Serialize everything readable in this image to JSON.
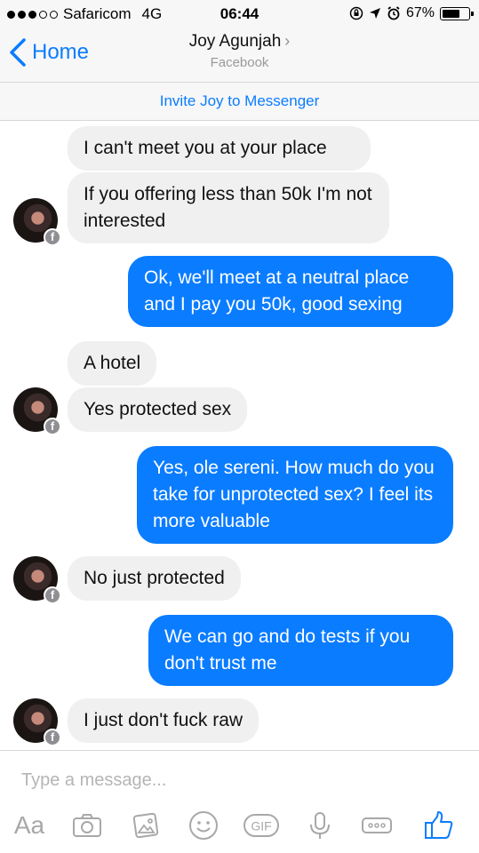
{
  "status_bar": {
    "carrier": "Safaricom",
    "network": "4G",
    "time": "06:44",
    "battery": "67%",
    "battery_level": 0.67
  },
  "nav": {
    "back_label": "Home",
    "contact_name": "Joy Agunjah",
    "chevron": "›",
    "subtitle": "Facebook"
  },
  "invite_banner": "Invite Joy to Messenger",
  "messages": [
    {
      "from": "them",
      "text": "I can't meet you at your place"
    },
    {
      "from": "them",
      "text": "If you offering less than 50k I'm not interested"
    },
    {
      "from": "me",
      "text": "Ok, we'll meet at a neutral place and I pay you 50k, good sexing"
    },
    {
      "from": "them",
      "text": "A hotel"
    },
    {
      "from": "them",
      "text": "Yes protected sex"
    },
    {
      "from": "me",
      "text": "Yes, ole sereni. How much do you take for unprotected sex? I feel its more valuable"
    },
    {
      "from": "them",
      "text": "No just protected"
    },
    {
      "from": "me",
      "text": "We can go and do tests if you don't trust me"
    },
    {
      "from": "them",
      "text": "I just don't fuck raw"
    }
  ],
  "avatar_badge": "f",
  "composer": {
    "placeholder": "Type a message...",
    "text_tool_label": "Aa",
    "gif_label": "GIF"
  },
  "icons": [
    "chevron-left-icon",
    "camera-icon",
    "gallery-icon",
    "emoji-icon",
    "gif-icon",
    "microphone-icon",
    "more-icon",
    "thumbs-up-icon"
  ],
  "colors": {
    "accent": "#0a7cff",
    "incoming_bubble": "#f0f0f0",
    "outgoing_text": "#ffffff"
  }
}
